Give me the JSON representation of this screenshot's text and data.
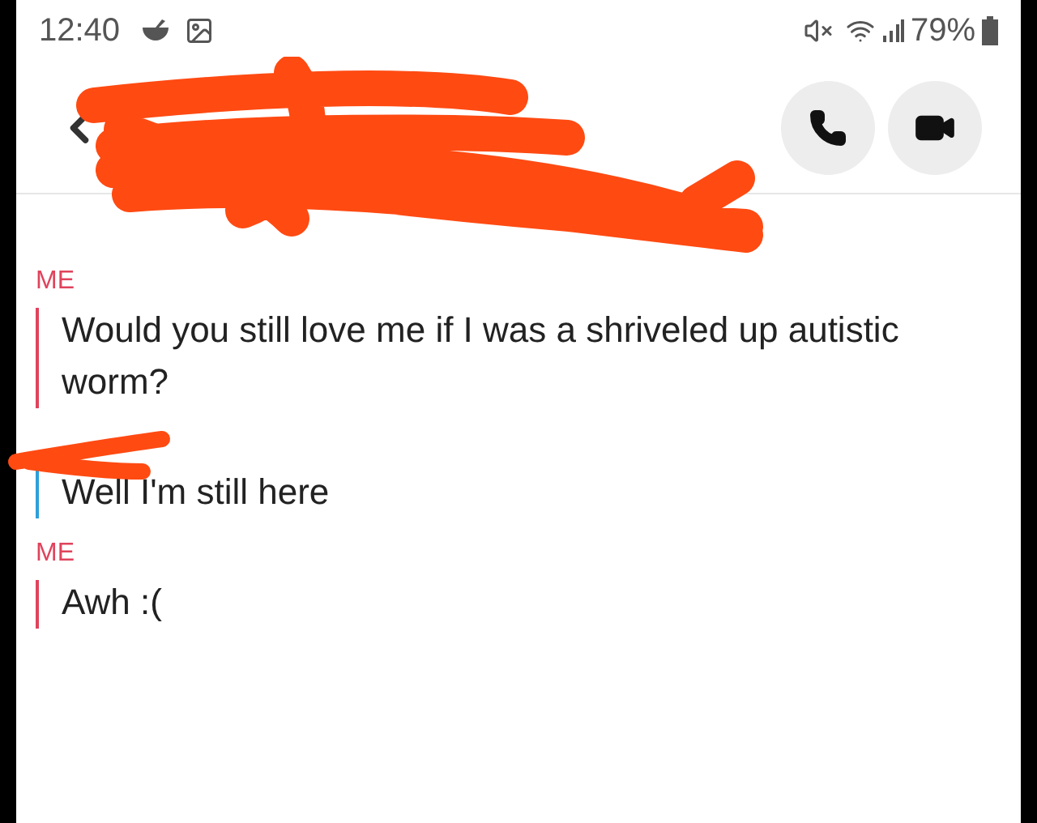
{
  "status_bar": {
    "time": "12:40",
    "battery": "79%"
  },
  "messages": [
    {
      "sender": "ME",
      "text": "Would you still love me if I was a shriveled up autistic worm?",
      "color": "#e0435c"
    },
    {
      "text": "Well I'm still here",
      "color": "#2d9fd8"
    },
    {
      "sender": "ME",
      "text": "Awh :(",
      "color": "#e0435c"
    }
  ]
}
